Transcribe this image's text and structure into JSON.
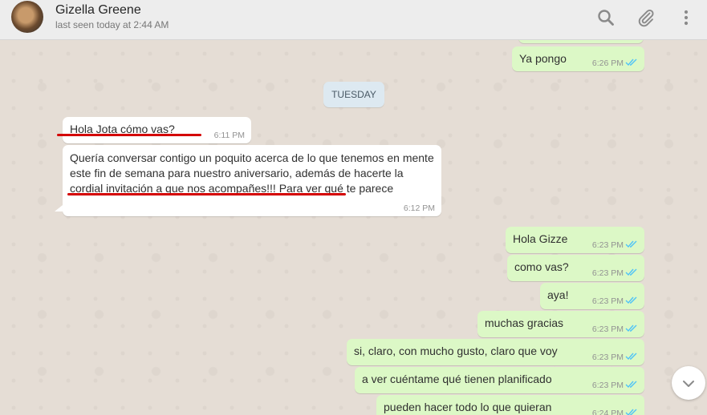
{
  "header": {
    "contact_name": "Gizella Greene",
    "last_seen": "last seen today at 2:44 AM",
    "icons": [
      "search-icon",
      "attach-icon",
      "menu-icon"
    ]
  },
  "colors": {
    "incoming": "#ffffff",
    "outgoing": "#dcf8c6",
    "read_ticks": "#4fc3f7",
    "annotation": "#d40000"
  },
  "messages": [
    {
      "dir": "out",
      "text": "Ya pongo",
      "time": "6:26 PM",
      "read": true
    },
    {
      "dir": "divider",
      "text": "TUESDAY"
    },
    {
      "dir": "in",
      "text": "Hola Jota cómo vas?",
      "time": "6:11 PM"
    },
    {
      "dir": "in",
      "text": "Quería conversar contigo un poquito acerca de lo que tenemos en mente este fin de semana para nuestro aniversario, además de hacerte la cordial invitación a que nos acompañes!!! Para ver qué te parece",
      "time": "6:12 PM"
    },
    {
      "dir": "out",
      "text": "Hola Gizze",
      "time": "6:23 PM",
      "read": true
    },
    {
      "dir": "out",
      "text": "como vas?",
      "time": "6:23 PM",
      "read": true
    },
    {
      "dir": "out",
      "text": "aya!",
      "time": "6:23 PM",
      "read": true
    },
    {
      "dir": "out",
      "text": "muchas gracias",
      "time": "6:23 PM",
      "read": true
    },
    {
      "dir": "out",
      "text": "si, claro, con mucho gusto, claro que voy",
      "time": "6:23 PM",
      "read": true
    },
    {
      "dir": "out",
      "text": "a ver cuéntame qué tienen planificado",
      "time": "6:23 PM",
      "read": true
    },
    {
      "dir": "out",
      "text": "pueden hacer todo lo que quieran",
      "time": "6:24 PM",
      "read": true
    }
  ]
}
